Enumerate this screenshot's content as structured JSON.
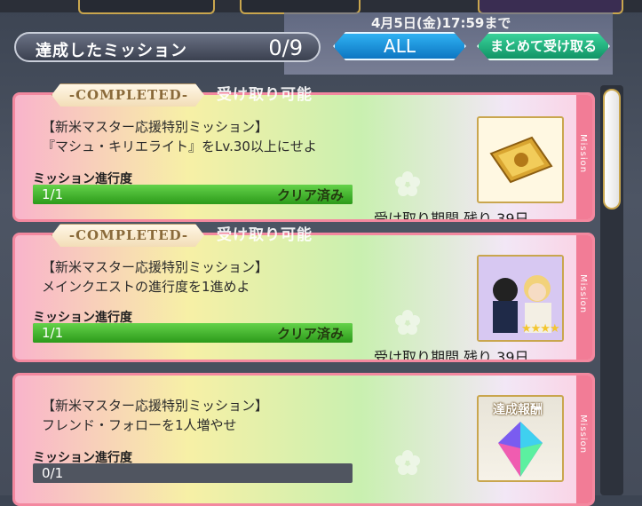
{
  "banner": {
    "date_text": "4月5日(金)17:59まで"
  },
  "header": {
    "title": "達成したミッション",
    "count": "0/9"
  },
  "buttons": {
    "all": "ALL",
    "collect_all": "まとめて受け取る"
  },
  "cards": [
    {
      "completed": "-COMPLETED-",
      "stamp": "受け取り可能",
      "category": "【新米マスター応援特別ミッション】",
      "description": "『マシュ・キリエライト』をLv.30以上にせよ",
      "progress_label": "ミッション進行度",
      "progress_value": "1/1",
      "progress_fraction": 1.0,
      "status": "クリア済み",
      "period": "受け取り期間 残り 39日",
      "side_label": "Mission",
      "reward_icon": "gold-ticket-icon"
    },
    {
      "completed": "-COMPLETED-",
      "stamp": "受け取り可能",
      "category": "【新米マスター応援特別ミッション】",
      "description": "メインクエストの進行度を1進めよ",
      "progress_label": "ミッション進行度",
      "progress_value": "1/1",
      "progress_fraction": 1.0,
      "status": "クリア済み",
      "period": "受け取り期間 残り 39日",
      "side_label": "Mission",
      "reward_icon": "character-card-icon",
      "reward_stars": "★★★★"
    },
    {
      "category": "【新米マスター応援特別ミッション】",
      "description": "フレンド・フォローを1人増やせ",
      "progress_label": "ミッション進行度",
      "progress_value": "0/1",
      "progress_fraction": 0.0,
      "side_label": "Mission",
      "reward_label": "達成報酬",
      "reward_icon": "crystal-icon"
    }
  ],
  "colors": {
    "card_border": "#f3889f",
    "progress_fill": "#3fb32a",
    "btn_all": "#1a8fd8",
    "btn_collect": "#1fb07c"
  }
}
